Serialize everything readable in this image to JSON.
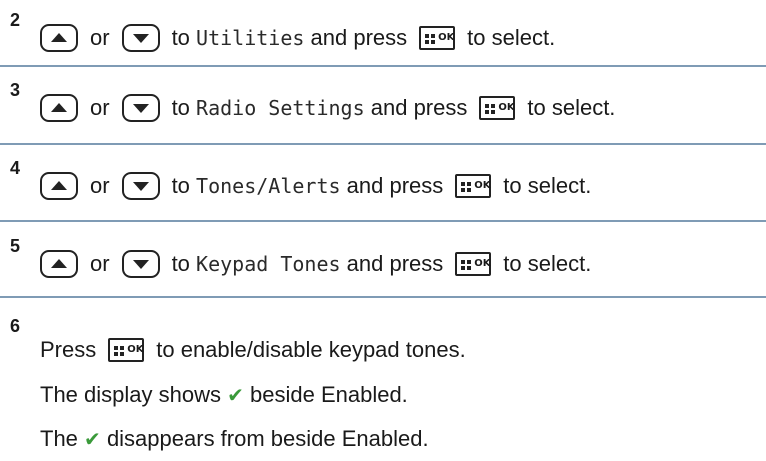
{
  "steps": [
    {
      "number": "2",
      "connector": "or",
      "text_to": "to",
      "menu_item": "Utilities",
      "text_and_press": "and press",
      "text_select": "to select."
    },
    {
      "number": "3",
      "connector": "or",
      "text_to": "to",
      "menu_item": "Radio Settings",
      "text_and_press": "and press",
      "text_select": "to select."
    },
    {
      "number": "4",
      "connector": "or",
      "text_to": "to",
      "menu_item": "Tones/Alerts",
      "text_and_press": "and press",
      "text_select": "to select."
    },
    {
      "number": "5",
      "connector": "or",
      "text_to": "to",
      "menu_item": "Keypad Tones",
      "text_and_press": "and press",
      "text_select": "to select."
    }
  ],
  "step6": {
    "number": "6",
    "press_label": "Press",
    "action_text": "to enable/disable keypad tones.",
    "result_enabled_pre": "The display shows",
    "result_enabled_post": "beside Enabled.",
    "result_disabled_pre": "The",
    "result_disabled_post": "disappears from beside Enabled."
  },
  "icons": {
    "check_glyph": "✔",
    "ok_button_text": "OK",
    "check_color": "#3a9a3a",
    "separator_color": "#7f9bb5"
  }
}
